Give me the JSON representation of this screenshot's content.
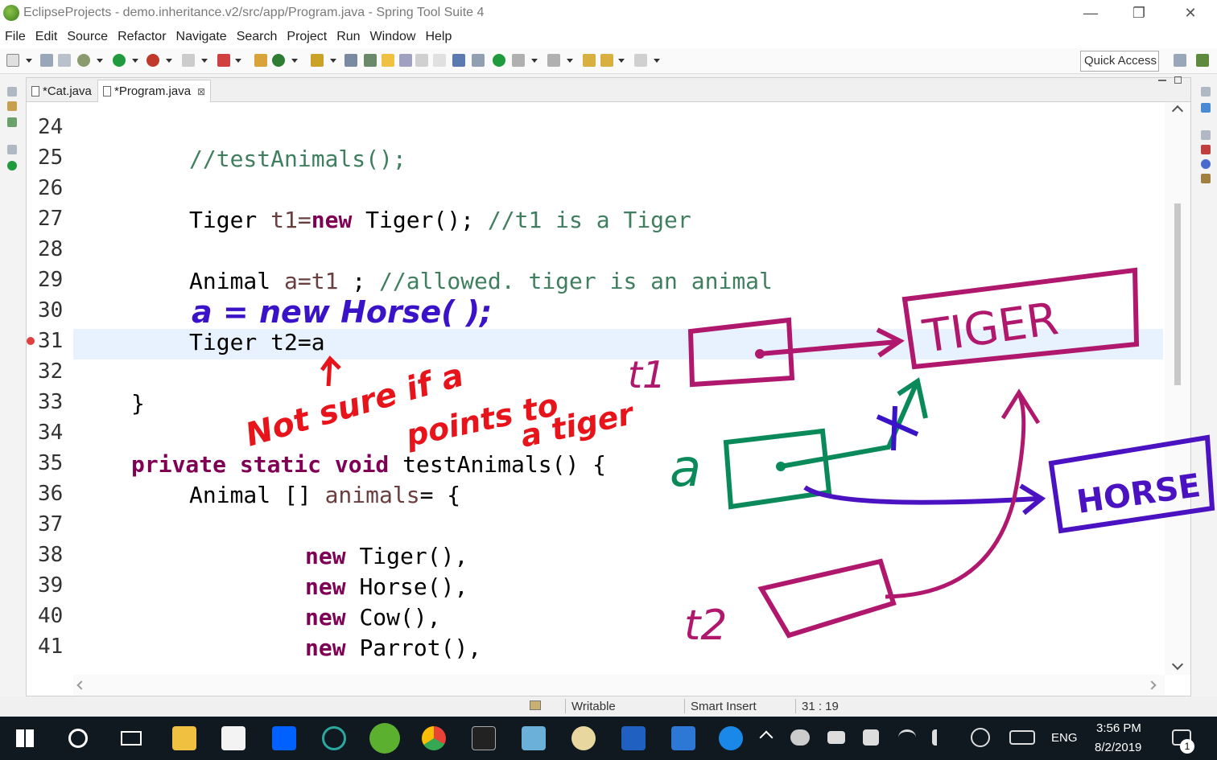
{
  "window": {
    "title": "EclipseProjects - demo.inheritance.v2/src/app/Program.java - Spring Tool Suite 4",
    "minimize": "—",
    "restore": "❐",
    "close": "✕"
  },
  "menu": [
    "File",
    "Edit",
    "Source",
    "Refactor",
    "Navigate",
    "Search",
    "Project",
    "Run",
    "Window",
    "Help"
  ],
  "quick_access": "Quick Access",
  "tabs": [
    {
      "label": "*Cat.java"
    },
    {
      "label": "*Program.java",
      "close": "⊠"
    }
  ],
  "line_numbers": [
    "24",
    "25",
    "26",
    "27",
    "28",
    "29",
    "30",
    "31",
    "32",
    "33",
    "34",
    "35",
    "36",
    "37",
    "38",
    "39",
    "40",
    "41"
  ],
  "code": {
    "l25": {
      "comment": "//testAnimals();"
    },
    "l27": {
      "type": "Tiger",
      "var": "t1=",
      "kw": "new",
      "rest": "Tiger();",
      "comment": "//t1 is a Tiger"
    },
    "l29": {
      "type": "Animal",
      "var": "a=t1",
      "semi": ";",
      "comment": "//allowed. tiger is an animal"
    },
    "l31": {
      "text": "Tiger t2=a"
    },
    "l33": {
      "text": "}"
    },
    "l35": {
      "kw": "private static void",
      "rest": "testAnimals() {"
    },
    "l36": {
      "type": "Animal []",
      "var": "animals",
      "rest": "= {"
    },
    "l38": {
      "kw": "new",
      "rest": "Tiger(),"
    },
    "l39": {
      "kw": "new",
      "rest": "Horse(),"
    },
    "l40": {
      "kw": "new",
      "rest": "Cow(),"
    },
    "l41": {
      "kw": "new",
      "rest": "Parrot(),"
    }
  },
  "annotations": {
    "blue_line": "a = new Horse( );",
    "red_note": [
      "Not sure if a",
      "points to",
      "a tiger"
    ],
    "labels": {
      "t1": "t1",
      "a": "a",
      "t2": "t2",
      "tiger": "TIGER",
      "horse": "HORSE"
    }
  },
  "status": {
    "writable": "Writable",
    "insert_mode": "Smart Insert",
    "position": "31 : 19"
  },
  "taskbar": {
    "time": "3:56 PM",
    "date": "8/2/2019",
    "lang": "ENG",
    "notifications": "1"
  },
  "colors": {
    "keyword": "#7f0055",
    "comment": "#3f7f5f",
    "ink_blue": "#3a12c8",
    "ink_red": "#e8141c",
    "ink_magenta": "#b0186e",
    "ink_green": "#0a8a5a",
    "ink_purple": "#4a12c0"
  }
}
